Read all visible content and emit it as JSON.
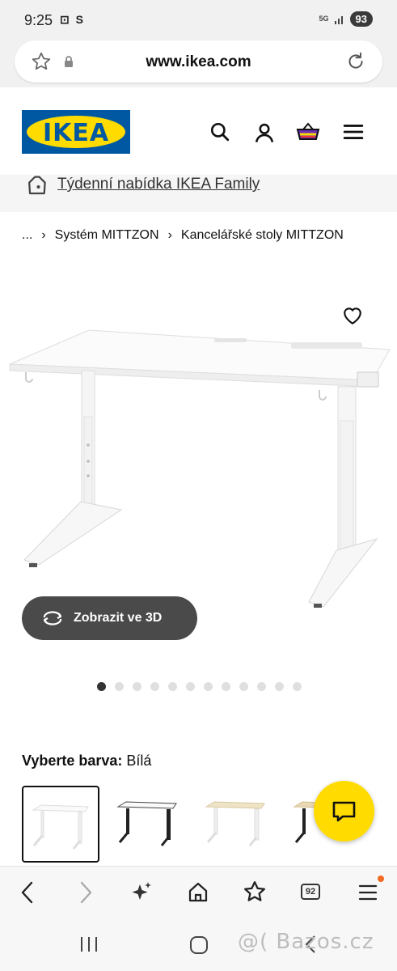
{
  "status": {
    "time": "9:25",
    "left_icons": "⊡ S",
    "network": "5G",
    "battery": "93"
  },
  "browser": {
    "url": "www.ikea.com",
    "tab_count": "92"
  },
  "header": {
    "logo_text": "IKEA"
  },
  "family_banner": {
    "text": "Týdenní nabídka IKEA Family"
  },
  "breadcrumb": {
    "ellipsis": "...",
    "items": [
      "Systém MITTZON",
      "Kancelářské stoly MITTZON"
    ]
  },
  "product": {
    "view_3d_label": "Zobrazit ve 3D",
    "image_count": 12,
    "active_image": 1
  },
  "color_select": {
    "label": "Vyberte barva:",
    "value": "Bílá",
    "swatches": [
      "white",
      "white-black",
      "birch-white",
      "oak-black"
    ]
  },
  "watermark": "@( Bazos.cz",
  "colors": {
    "ikea_blue": "#0058a3",
    "ikea_yellow": "#ffdb00",
    "button_dark": "#4a4a4a"
  }
}
